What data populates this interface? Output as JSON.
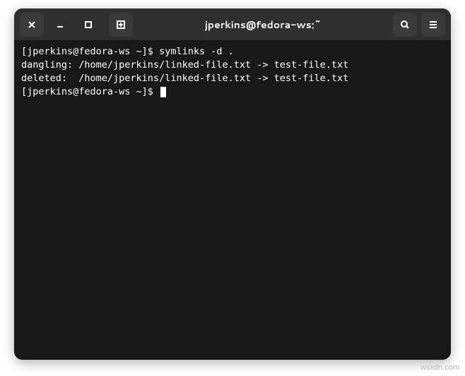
{
  "titlebar": {
    "title": "jperkins@fedora-ws:~"
  },
  "terminal": {
    "lines": [
      {
        "prompt": "[jperkins@fedora-ws ~]$ ",
        "cmd": "symlinks -d ."
      },
      {
        "text": "dangling: /home/jperkins/linked-file.txt -> test-file.txt"
      },
      {
        "text": "deleted:  /home/jperkins/linked-file.txt -> test-file.txt"
      },
      {
        "prompt": "[jperkins@fedora-ws ~]$ ",
        "cmd": "",
        "cursor": true
      }
    ]
  },
  "watermark": "wsxdn.com"
}
